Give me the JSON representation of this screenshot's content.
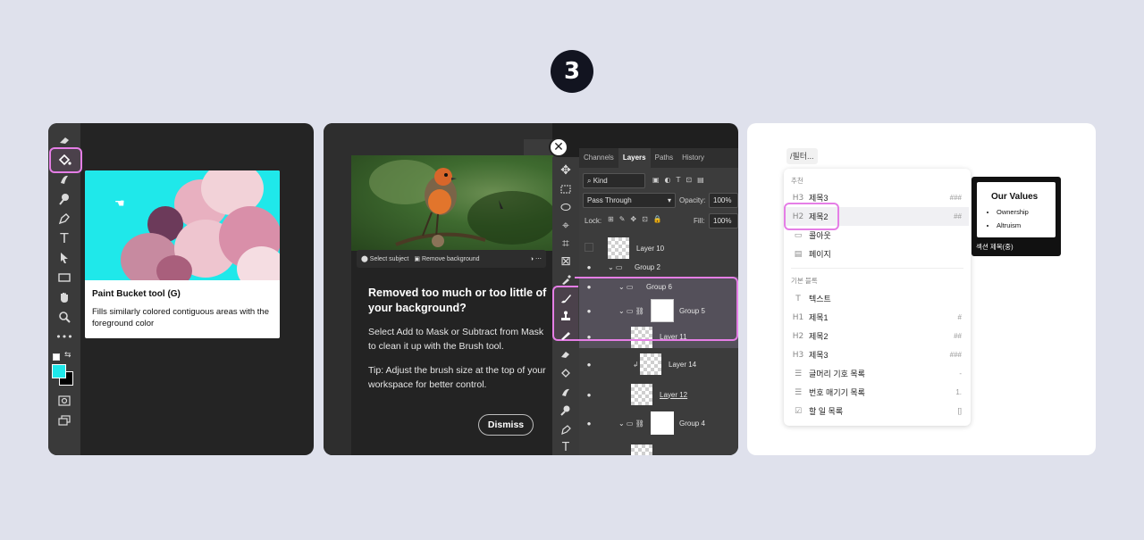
{
  "step": "3",
  "p1": {
    "tooltip_title": "Paint Bucket tool (G)",
    "tooltip_desc": "Fills similarly colored contiguous areas with the foreground color",
    "colors": {
      "foreground": "#1fe8ea",
      "background": "#000000",
      "highlight": "#e57ee6"
    }
  },
  "p2": {
    "tabs": [
      "Channels",
      "Layers",
      "Paths",
      "History"
    ],
    "kind_label": "Kind",
    "blend_mode": "Pass Through",
    "opacity_label": "Opacity:",
    "opacity_value": "100%",
    "lock_label": "Lock:",
    "fill_label": "Fill:",
    "fill_value": "100%",
    "select_subject": "Select subject",
    "remove_background": "Remove background",
    "tip_title": "Removed too much or too little of your background?",
    "tip_p1": "Select Add to Mask or Subtract from Mask to clean it up with the Brush tool.",
    "tip_p2": "Tip: Adjust the brush size at the top of your workspace for better control.",
    "dismiss": "Dismiss",
    "close_glyph": "✕",
    "layers": [
      "Layer 10",
      "Group 2",
      "Group 6",
      "Group 5",
      "Layer 11",
      "Layer 14",
      "Layer 12",
      "Group 4"
    ]
  },
  "p3": {
    "filter": "/필터...",
    "section_recommended": "추천",
    "recommended": [
      {
        "icon": "H3",
        "label": "제목3",
        "shortcut": "###"
      },
      {
        "icon": "H2",
        "label": "제목2",
        "shortcut": "##"
      },
      {
        "icon": "▭",
        "label": "콜아웃",
        "shortcut": ""
      },
      {
        "icon": "▤",
        "label": "페이지",
        "shortcut": ""
      }
    ],
    "section_basic": "기본 블록",
    "basic": [
      {
        "icon": "T",
        "label": "텍스트",
        "shortcut": ""
      },
      {
        "icon": "H1",
        "label": "제목1",
        "shortcut": "#"
      },
      {
        "icon": "H2",
        "label": "제목2",
        "shortcut": "##"
      },
      {
        "icon": "H3",
        "label": "제목3",
        "shortcut": "###"
      },
      {
        "icon": "☰",
        "label": "글머리 기호 목록",
        "shortcut": "-"
      },
      {
        "icon": "☰",
        "label": "번호 매기기 목록",
        "shortcut": "1."
      },
      {
        "icon": "☑",
        "label": "할 일 목록",
        "shortcut": "[]"
      }
    ],
    "preview_title": "Our Values",
    "preview_items": [
      "Ownership",
      "Altruism"
    ],
    "preview_caption": "섹션 제목(중)"
  }
}
